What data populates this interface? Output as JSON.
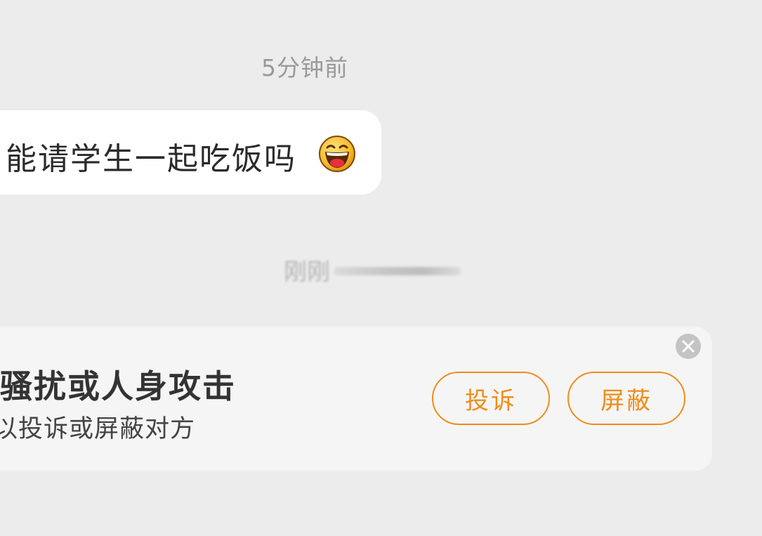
{
  "chat": {
    "timestamp": "5分钟前",
    "message": {
      "text": "能请学生一起吃饭吗",
      "emoji": "laughing-face"
    },
    "system_notice_visible": "刚刚"
  },
  "harassment_notice": {
    "title": "骚扰或人身攻击",
    "subtitle": "以投诉或屏蔽对方",
    "report_label": "投诉",
    "block_label": "屏蔽",
    "close_icon": "close-icon"
  },
  "colors": {
    "background": "#ececec",
    "bubble": "#ffffff",
    "notice_background": "#f5f5f5",
    "accent": "#f08c1a",
    "timestamp": "#9a9a9a"
  }
}
